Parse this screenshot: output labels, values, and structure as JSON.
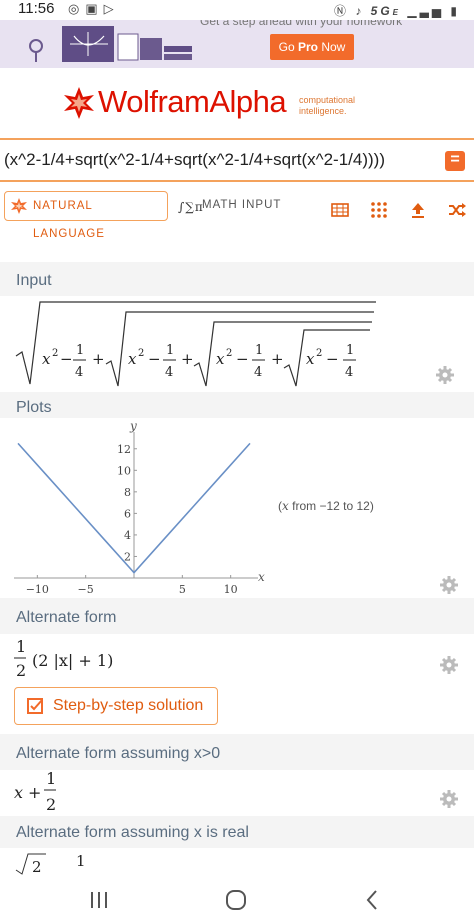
{
  "status_bar": {
    "time": "11:56",
    "network": "5G",
    "network_sub": "E"
  },
  "banner": {
    "promo_text": "Get a step ahead with your homework",
    "go_pro_prefix": "Go ",
    "go_pro_bold": "Pro",
    "go_pro_suffix": " Now"
  },
  "logo": {
    "word1": "Wolfram",
    "word2": "Alpha",
    "tagline_line1": "computational",
    "tagline_line2": "intelligence."
  },
  "query": {
    "value": "(x^2-1/4+sqrt(x^2-1/4+sqrt(x^2-1/4+sqrt(x^2-1/4))))",
    "go_label": "="
  },
  "modes": {
    "natural_language": "NATURAL LANGUAGE",
    "math_input": "MATH INPUT",
    "math_input_icon": "∫∑π"
  },
  "toolbar": {
    "icons": [
      "keyboard-icon",
      "grid-icon",
      "upload-icon",
      "shuffle-icon"
    ]
  },
  "pods": {
    "input": {
      "title": "Input"
    },
    "plots": {
      "title": "Plots",
      "range_text_prefix": "(",
      "range_var": "x",
      "range_text_suffix": " from −12 to 12)"
    },
    "alt_form": {
      "title": "Alternate form",
      "step_button": "Step-by-step solution"
    },
    "alt_form_pos": {
      "title": "Alternate form assuming x>0"
    },
    "alt_form_real": {
      "title": "Alternate form assuming x is real"
    }
  },
  "input_math": {
    "x2": "x",
    "exp": "2",
    "minus": "−",
    "num": "1",
    "den": "4",
    "plus": "+"
  },
  "alt_form_math": {
    "num": "1",
    "den": "2",
    "expr": "(2 |x| + 1)"
  },
  "alt_pos_math": {
    "x": "x",
    "plus": "+",
    "num": "1",
    "den": "2"
  },
  "alt_real_math": {
    "sqrt_content": "2",
    "num": "1"
  },
  "chart_data": {
    "type": "line",
    "title": "",
    "xlabel": "x",
    "ylabel": "y",
    "xlim": [
      -12,
      12
    ],
    "ylim": [
      0,
      13
    ],
    "xticks": [
      -10,
      -5,
      5,
      10
    ],
    "yticks": [
      2,
      4,
      6,
      8,
      10,
      12
    ],
    "series": [
      {
        "x": [
          -12,
          -9,
          -6,
          -3,
          0,
          3,
          6,
          9,
          12
        ],
        "y": [
          12.5,
          9.5,
          6.5,
          3.5,
          0.5,
          3.5,
          6.5,
          9.5,
          12.5
        ]
      }
    ],
    "line_color": "#6a90c6",
    "grid": false
  }
}
